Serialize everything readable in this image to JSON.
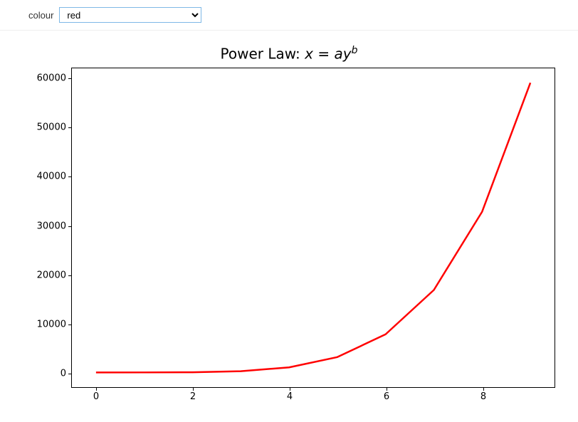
{
  "controls": {
    "label": "colour",
    "selected": "red",
    "options": [
      "red"
    ]
  },
  "chart_data": {
    "type": "line",
    "title_prefix": "Power Law: ",
    "title_formula": "x = ay^b",
    "x": [
      0,
      1,
      2,
      3,
      4,
      5,
      6,
      7,
      8,
      9
    ],
    "y": [
      0,
      1,
      32,
      243,
      1024,
      3125,
      7776,
      16807,
      32768,
      59049
    ],
    "xlabel": "",
    "ylabel": "",
    "xlim": [
      -0.5,
      9.5
    ],
    "ylim": [
      -3000,
      62000
    ],
    "xticks": [
      0,
      2,
      4,
      6,
      8
    ],
    "yticks": [
      0,
      10000,
      20000,
      30000,
      40000,
      50000,
      60000
    ],
    "line_color": "#ff0000",
    "line_width": 2.5
  }
}
